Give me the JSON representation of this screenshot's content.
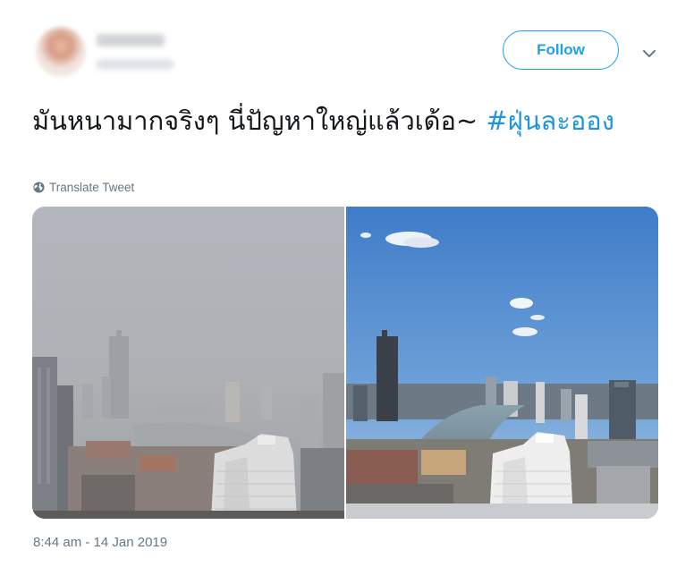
{
  "author": {
    "avatar": "avatar-photo-blurred"
  },
  "follow_button": {
    "label": "Follow"
  },
  "menu": {
    "icon": "chevron-down-icon"
  },
  "tweet": {
    "text_before": "มันหนามากจริงๆ นี่ปัญหาใหญ่แล้วเด้อ~ ",
    "hashtag": "#ฝุ่นละออง"
  },
  "translate": {
    "icon": "globe-icon",
    "label": "Translate Tweet"
  },
  "media": [
    {
      "name": "photo-hazy-city",
      "description_icon": "image"
    },
    {
      "name": "photo-clear-city",
      "description_icon": "image"
    }
  ],
  "timestamp": "8:44 am - 14 Jan 2019",
  "colors": {
    "accent": "#1da1f2",
    "hashtag": "#1b95e0",
    "muted": "#657786",
    "text": "#14171a"
  }
}
